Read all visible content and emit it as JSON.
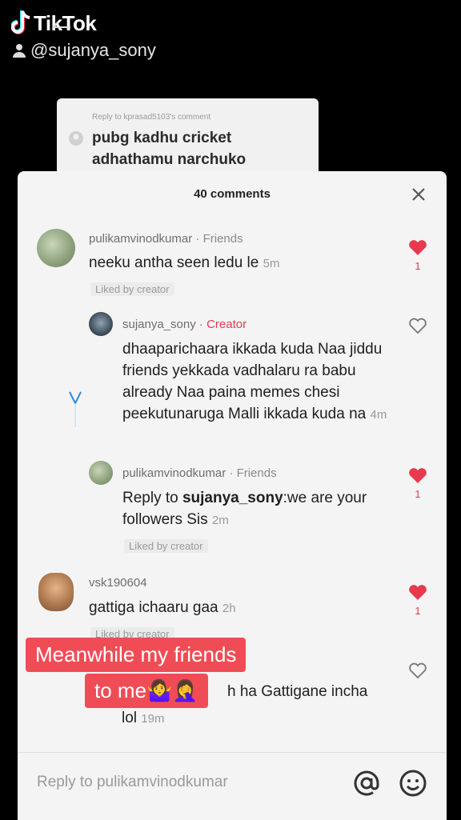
{
  "watermark": {
    "brand": "TikTok",
    "username": "@sujanya_sony"
  },
  "reply_card": {
    "header": "Reply to kprasad5103's comment",
    "text": "pubg kadhu cricket adhathamu narchuko"
  },
  "sheet": {
    "title": "40 comments"
  },
  "comments": [
    {
      "username": "pulikamvinodkumar",
      "tag": "· Friends",
      "text": "neeku antha seen ledu le",
      "time": "5m",
      "liked_by_creator": "Liked by creator",
      "liked": true,
      "likes": "1"
    },
    {
      "username": "sujanya_sony",
      "tag": "· Creator",
      "text": "dhaaparichaara ikkada kuda Naa jiddu friends yekkada vadhalaru ra babu already Naa paina memes chesi peekutunaruga Malli ikkada kuda na",
      "time": "4m",
      "liked": false
    },
    {
      "username": "pulikamvinodkumar",
      "tag": "· Friends",
      "reply_prefix": "Reply to",
      "reply_to": "sujanya_sony",
      "text": ":we are your followers Sis",
      "time": "2m",
      "liked_by_creator": "Liked by creator",
      "liked": true,
      "likes": "1"
    },
    {
      "username": "vsk190604",
      "text": "gattiga ichaaru gaa",
      "time": "2h",
      "liked_by_creator": "Liked by creator",
      "liked": true,
      "likes": "1"
    },
    {
      "partial_text": "h ha Gattigane incha",
      "partial_text2": "lol",
      "time": "19m",
      "liked": false
    }
  ],
  "overlay_caption": {
    "line1": "Meanwhile my friends",
    "line2": "to me🤷‍♀️🤦‍♀️"
  },
  "reply_bar": {
    "placeholder": "Reply to pulikamvinodkumar"
  },
  "colors": {
    "accent": "#e8394f",
    "caption_bg": "#f04c55",
    "sheet_bg": "#f4f4f4"
  }
}
